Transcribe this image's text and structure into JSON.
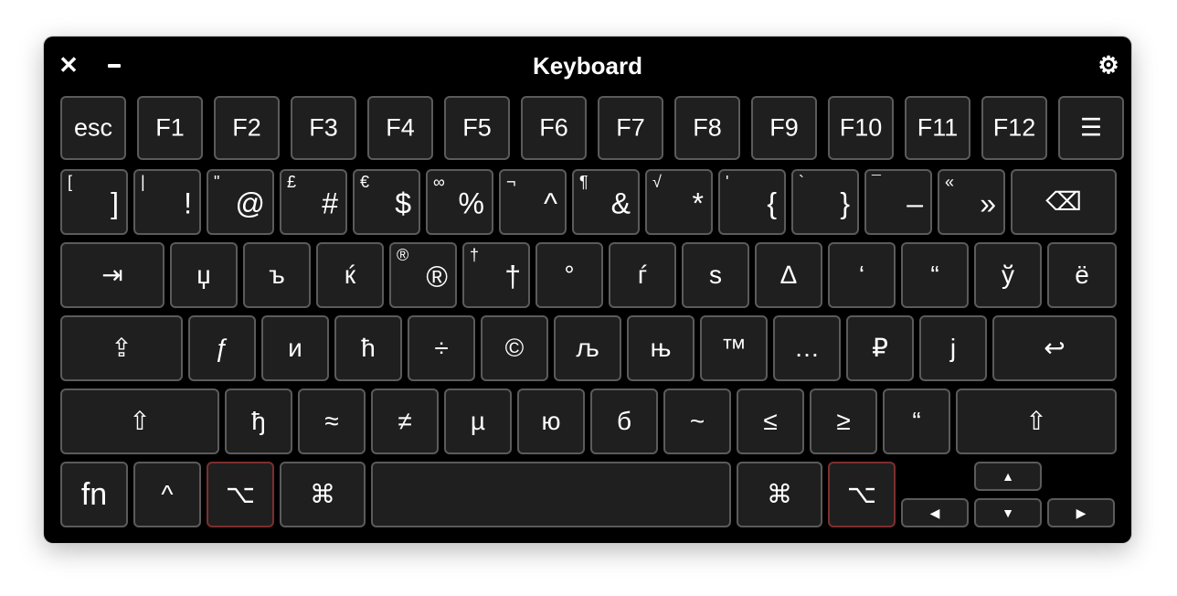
{
  "window": {
    "title": "Keyboard",
    "close_icon": "close-icon",
    "minimize_icon": "minimize-icon",
    "settings_icon": "gear-icon",
    "close_glyph": "✕",
    "gear_glyph": "⚙"
  },
  "rows": {
    "function": [
      {
        "label": "esc",
        "name": "key-esc"
      },
      {
        "label": "F1",
        "name": "key-f1"
      },
      {
        "label": "F2",
        "name": "key-f2"
      },
      {
        "label": "F3",
        "name": "key-f3"
      },
      {
        "label": "F4",
        "name": "key-f4"
      },
      {
        "label": "F5",
        "name": "key-f5"
      },
      {
        "label": "F6",
        "name": "key-f6"
      },
      {
        "label": "F7",
        "name": "key-f7"
      },
      {
        "label": "F8",
        "name": "key-f8"
      },
      {
        "label": "F9",
        "name": "key-f9"
      },
      {
        "label": "F10",
        "name": "key-f10"
      },
      {
        "label": "F11",
        "name": "key-f11"
      },
      {
        "label": "F12",
        "name": "key-f12"
      },
      {
        "label": "☰",
        "name": "key-menu",
        "icon": "menu-icon"
      }
    ],
    "number": [
      {
        "secondary": "[",
        "label": "]",
        "name": "key-bracket"
      },
      {
        "secondary": "|",
        "label": "!",
        "name": "key-1"
      },
      {
        "secondary": "\"",
        "label": "@",
        "name": "key-2"
      },
      {
        "secondary": "£",
        "label": "#",
        "name": "key-3"
      },
      {
        "secondary": "€",
        "label": "$",
        "name": "key-4"
      },
      {
        "secondary": "∞",
        "label": "%",
        "name": "key-5"
      },
      {
        "secondary": "¬",
        "label": "^",
        "name": "key-6"
      },
      {
        "secondary": "¶",
        "label": "&",
        "name": "key-7"
      },
      {
        "secondary": "√",
        "label": "*",
        "name": "key-8"
      },
      {
        "secondary": "'",
        "label": "{",
        "name": "key-9"
      },
      {
        "secondary": "`",
        "label": "}",
        "name": "key-0"
      },
      {
        "secondary": "¯",
        "label": "–",
        "name": "key-minus"
      },
      {
        "secondary": "«",
        "label": "»",
        "name": "key-equals"
      },
      {
        "label": "⌫",
        "name": "key-delete",
        "icon": "delete-icon"
      }
    ],
    "top": [
      {
        "label": "⇥",
        "name": "key-tab",
        "icon": "tab-icon"
      },
      {
        "label": "џ",
        "name": "key-q"
      },
      {
        "label": "ъ",
        "name": "key-w"
      },
      {
        "label": "ќ",
        "name": "key-e"
      },
      {
        "secondary": "®",
        "label": "®",
        "name": "key-r"
      },
      {
        "secondary": "†",
        "label": "†",
        "name": "key-t"
      },
      {
        "label": "°",
        "name": "key-y"
      },
      {
        "label": "ѓ",
        "name": "key-u"
      },
      {
        "label": "s",
        "name": "key-i"
      },
      {
        "label": "∆",
        "name": "key-o"
      },
      {
        "label": "‘",
        "name": "key-p"
      },
      {
        "label": "“",
        "name": "key-left-bracket"
      },
      {
        "label": "ў",
        "name": "key-right-bracket"
      },
      {
        "label": "ё",
        "name": "key-backslash"
      }
    ],
    "home": [
      {
        "label": "⇪",
        "name": "key-caps-lock",
        "icon": "caps-lock-icon"
      },
      {
        "label": "ƒ",
        "name": "key-a"
      },
      {
        "label": "и",
        "name": "key-s"
      },
      {
        "label": "ћ",
        "name": "key-d"
      },
      {
        "label": "÷",
        "name": "key-f"
      },
      {
        "label": "©",
        "name": "key-g"
      },
      {
        "label": "љ",
        "name": "key-h"
      },
      {
        "label": "њ",
        "name": "key-j"
      },
      {
        "label": "™",
        "name": "key-k"
      },
      {
        "label": "…",
        "name": "key-l"
      },
      {
        "label": "₽",
        "name": "key-semicolon"
      },
      {
        "label": "j",
        "name": "key-quote"
      },
      {
        "label": "↩",
        "name": "key-return",
        "icon": "return-icon"
      }
    ],
    "bottom": [
      {
        "label": "⇧",
        "name": "key-shift-left",
        "icon": "shift-icon"
      },
      {
        "label": "ђ",
        "name": "key-z"
      },
      {
        "label": "≈",
        "name": "key-x"
      },
      {
        "label": "≠",
        "name": "key-c"
      },
      {
        "label": "µ",
        "name": "key-v"
      },
      {
        "label": "ю",
        "name": "key-b"
      },
      {
        "label": "б",
        "name": "key-n"
      },
      {
        "label": "~",
        "name": "key-m"
      },
      {
        "label": "≤",
        "name": "key-comma"
      },
      {
        "label": "≥",
        "name": "key-period"
      },
      {
        "label": "“",
        "name": "key-slash"
      },
      {
        "label": "⇧",
        "name": "key-shift-right",
        "icon": "shift-icon"
      }
    ],
    "modifiers": [
      {
        "label": "fn",
        "name": "key-fn"
      },
      {
        "label": "^",
        "name": "key-control",
        "icon": "control-icon"
      },
      {
        "label": "⌥",
        "name": "key-option-left",
        "icon": "option-icon",
        "highlighted": true
      },
      {
        "label": "⌘",
        "name": "key-command-left",
        "icon": "command-icon"
      },
      {
        "label": "",
        "name": "key-space"
      },
      {
        "label": "⌘",
        "name": "key-command-right",
        "icon": "command-icon"
      },
      {
        "label": "⌥",
        "name": "key-option-right",
        "icon": "option-icon",
        "highlighted": true
      }
    ],
    "arrows": [
      {
        "label": "▲",
        "name": "key-arrow-up",
        "icon": "arrow-up-icon"
      },
      {
        "label": "◀",
        "name": "key-arrow-left",
        "icon": "arrow-left-icon"
      },
      {
        "label": "▼",
        "name": "key-arrow-down",
        "icon": "arrow-down-icon"
      },
      {
        "label": "▶",
        "name": "key-arrow-right",
        "icon": "arrow-right-icon"
      }
    ]
  }
}
